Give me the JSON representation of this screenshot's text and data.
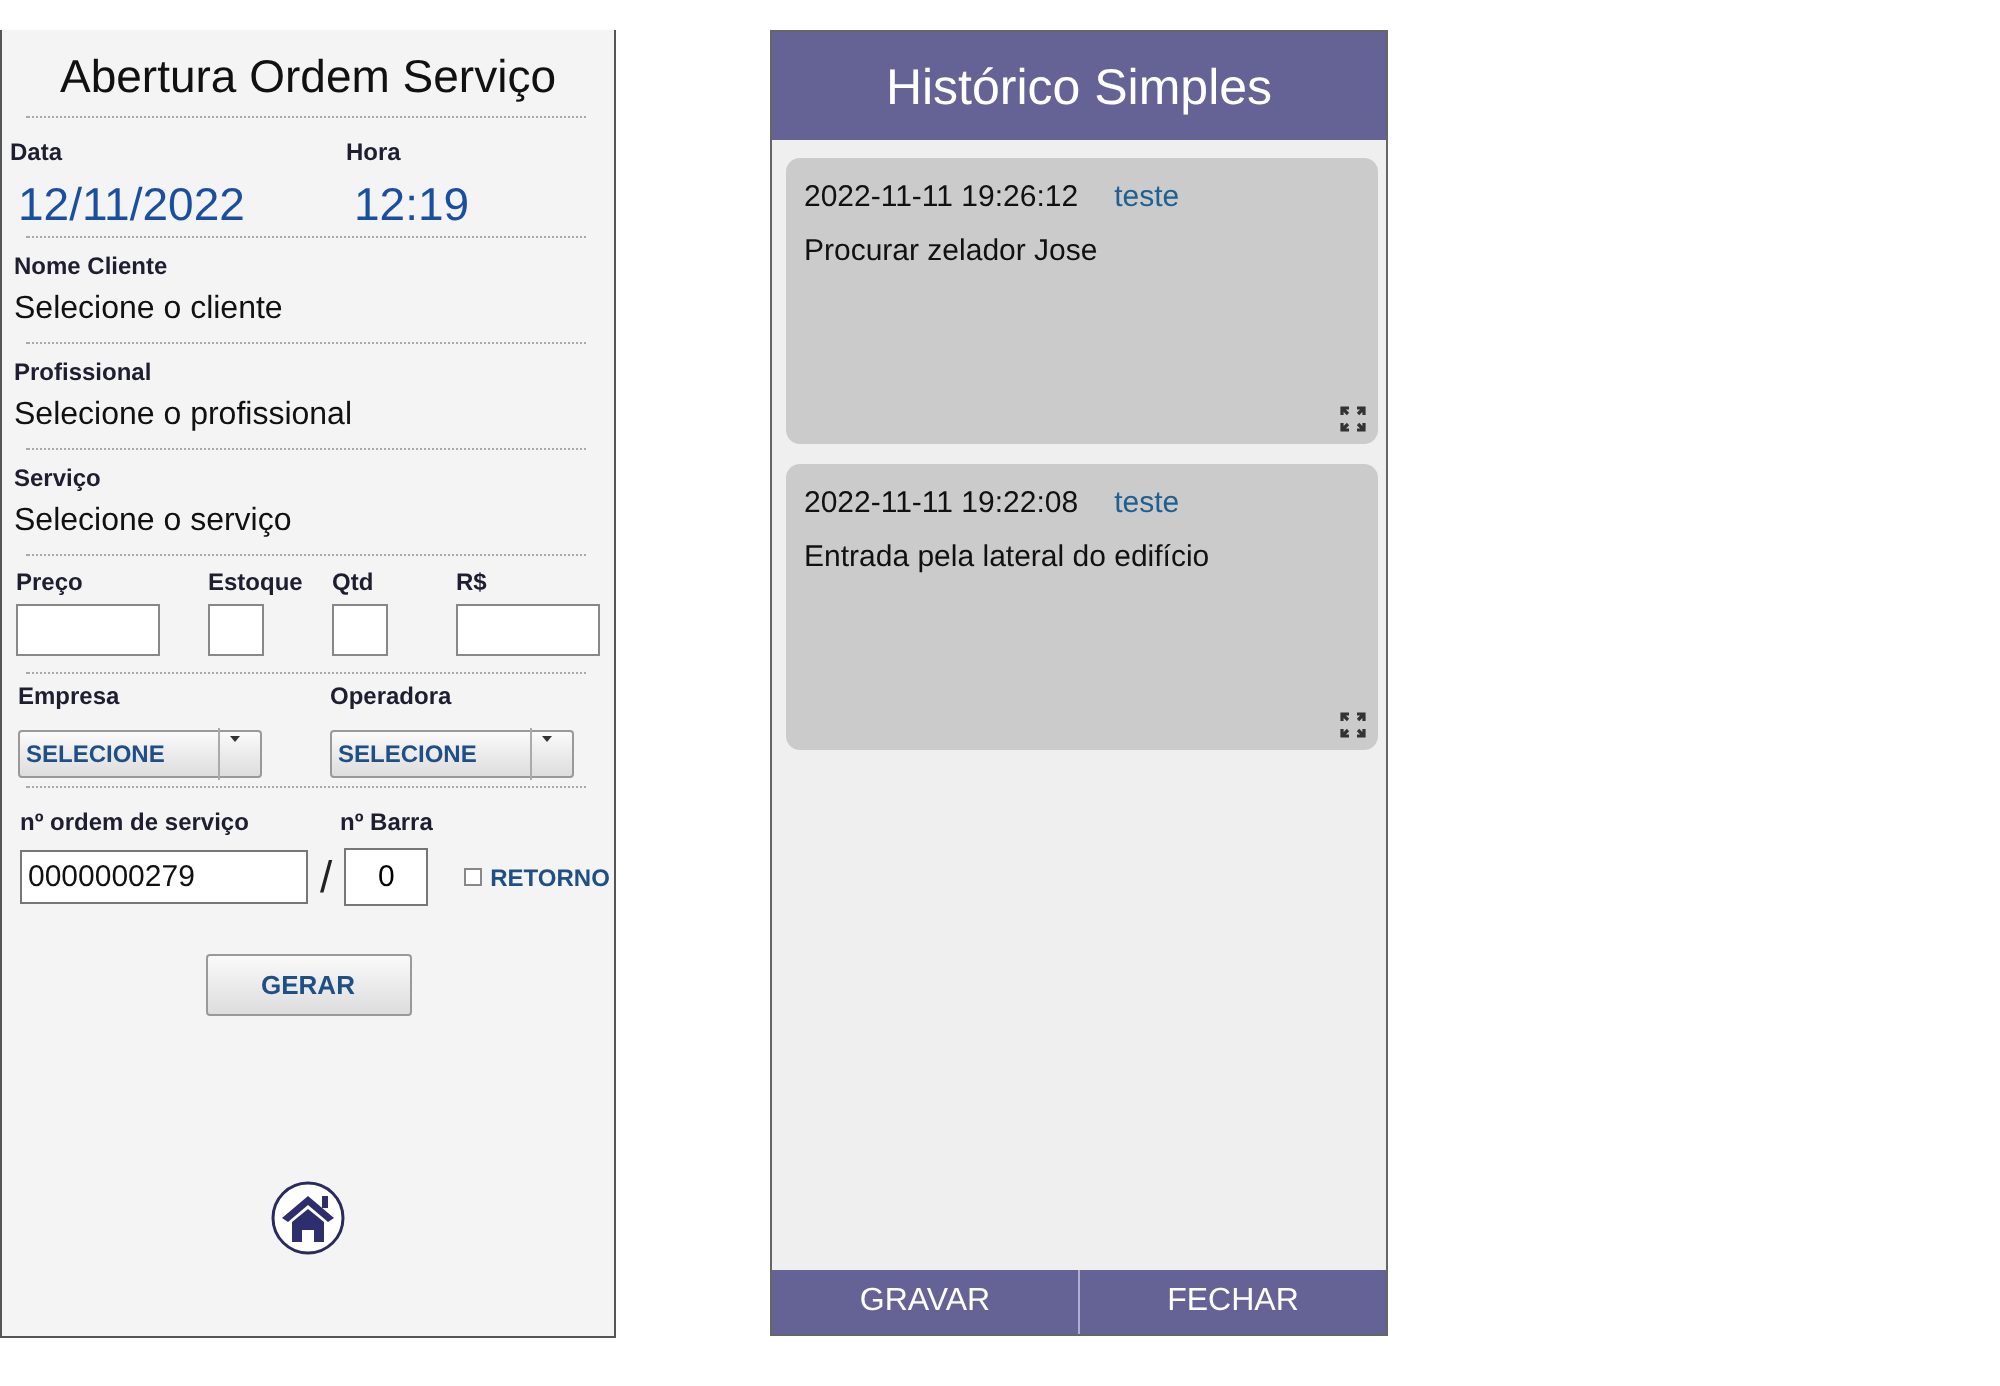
{
  "order_form": {
    "title": "Abertura Ordem Serviço",
    "date": {
      "label": "Data",
      "value": "12/11/2022"
    },
    "time": {
      "label": "Hora",
      "value": "12:19"
    },
    "pickers": [
      {
        "label": "Nome Cliente",
        "value": "Selecione o cliente"
      },
      {
        "label": "Profissional",
        "value": "Selecione o profissional"
      },
      {
        "label": "Serviço",
        "value": "Selecione o serviço"
      }
    ],
    "amount_fields": [
      {
        "label": "Preço",
        "kind": "wide"
      },
      {
        "label": "Estoque",
        "kind": "narrow"
      },
      {
        "label": "Qtd",
        "kind": "narrow"
      },
      {
        "label": "R$",
        "kind": "wide"
      }
    ],
    "dropdowns": [
      {
        "label": "Empresa",
        "value": "SELECIONE"
      },
      {
        "label": "Operadora",
        "value": "SELECIONE"
      }
    ],
    "order_number": {
      "label": "nº ordem de serviço",
      "value": "0000000279"
    },
    "separator": "/",
    "bar_number": {
      "label": "nº Barra",
      "value": "0"
    },
    "return_checkbox": {
      "label": "RETORNO",
      "checked": false
    },
    "generate_button": "GERAR"
  },
  "history": {
    "title": "Histórico Simples",
    "entries": [
      {
        "timestamp": "2022-11-11 19:26:12",
        "user": "teste",
        "text": "Procurar zelador Jose"
      },
      {
        "timestamp": "2022-11-11 19:22:08",
        "user": "teste",
        "text": "Entrada pela lateral do edifício"
      }
    ],
    "buttons": [
      "GRAVAR",
      "FECHAR"
    ]
  }
}
